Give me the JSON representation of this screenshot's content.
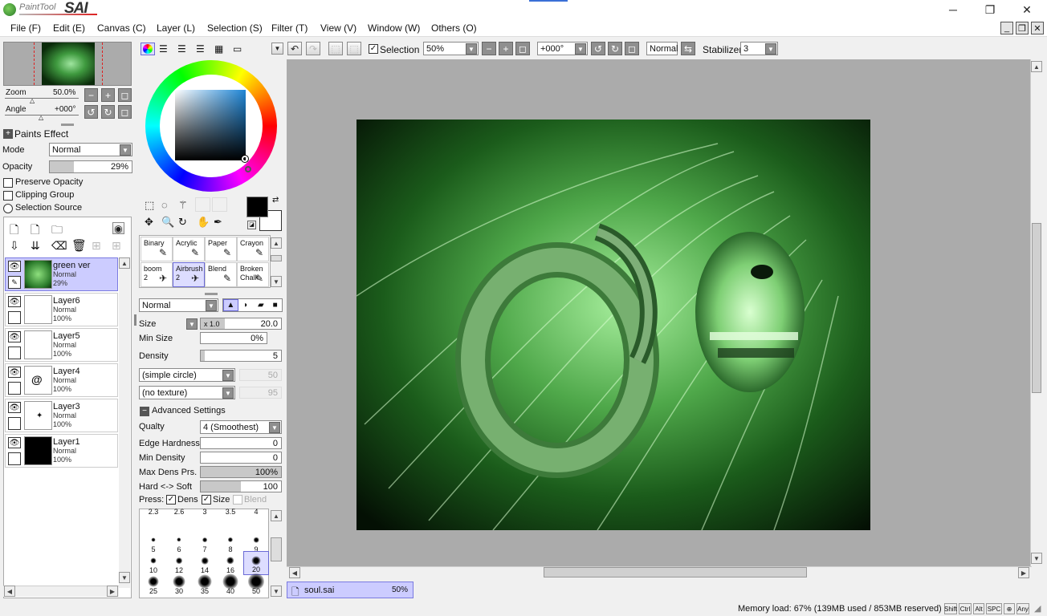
{
  "app": {
    "logo_small": "PaintTool",
    "logo_big": "SAI",
    "window_buttons": [
      "─",
      "❐",
      "✕"
    ]
  },
  "menu": [
    "File (F)",
    "Edit (E)",
    "Canvas (C)",
    "Layer (L)",
    "Selection (S)",
    "Filter (T)",
    "View (V)",
    "Window (W)",
    "Others (O)"
  ],
  "navigator": {
    "zoom_label": "Zoom",
    "zoom_value": "50.0%",
    "angle_label": "Angle",
    "angle_value": "+000°"
  },
  "paints_effect": {
    "header": "Paints Effect",
    "mode_label": "Mode",
    "mode_value": "Normal",
    "opacity_label": "Opacity",
    "opacity_value": "29%",
    "opacity_fraction": 0.29,
    "preserve_opacity": "Preserve Opacity",
    "clipping_group": "Clipping Group",
    "selection_source": "Selection Source"
  },
  "layers": [
    {
      "name": "green ver",
      "mode": "Normal",
      "opacity": "29%",
      "selected": true,
      "thumb": "green"
    },
    {
      "name": "Layer6",
      "mode": "Normal",
      "opacity": "100%",
      "selected": false,
      "thumb": "white"
    },
    {
      "name": "Layer5",
      "mode": "Normal",
      "opacity": "100%",
      "selected": false,
      "thumb": "white"
    },
    {
      "name": "Layer4",
      "mode": "Normal",
      "opacity": "100%",
      "selected": false,
      "thumb": "horn"
    },
    {
      "name": "Layer3",
      "mode": "Normal",
      "opacity": "100%",
      "selected": false,
      "thumb": "mark"
    },
    {
      "name": "Layer1",
      "mode": "Normal",
      "opacity": "100%",
      "selected": false,
      "thumb": "black"
    }
  ],
  "tools": [
    {
      "label": "Binary",
      "icon": "✎"
    },
    {
      "label": "Acrylic",
      "icon": "✎"
    },
    {
      "label": "Paper",
      "icon": "✎"
    },
    {
      "label": "Crayon",
      "icon": "✎"
    },
    {
      "label": "boom\n2",
      "icon": "✈"
    },
    {
      "label": "Airbrush\n2",
      "icon": "✈",
      "selected": true
    },
    {
      "label": "Blend",
      "icon": "✎"
    },
    {
      "label": "Broken\nChalk",
      "icon": "✎"
    }
  ],
  "brush": {
    "blend_mode": "Normal",
    "size_label": "Size",
    "size_mult": "x 1.0",
    "size_value": "20.0",
    "min_size_label": "Min Size",
    "min_size_value": "0%",
    "density_label": "Density",
    "density_value": "5",
    "shape": "(simple circle)",
    "shape_value": "50",
    "texture": "(no texture)",
    "texture_value": "95",
    "advanced_label": "Advanced Settings",
    "quality_label": "Qualty",
    "quality_value": "4 (Smoothest)",
    "edge_label": "Edge Hardness",
    "edge_value": "0",
    "min_density_label": "Min Density",
    "min_density_value": "0",
    "max_dens_label": "Max Dens Prs.",
    "max_dens_value": "100%",
    "hard_soft_label": "Hard <-> Soft",
    "hard_soft_value": "100",
    "press_label": "Press:",
    "press_dens": "Dens",
    "press_size": "Size",
    "press_blend": "Blend"
  },
  "brush_sizes": [
    "2.3",
    "2.6",
    "3",
    "3.5",
    "4",
    "5",
    "6",
    "7",
    "8",
    "9",
    "10",
    "12",
    "14",
    "16",
    "20",
    "25",
    "30",
    "35",
    "40",
    "50"
  ],
  "toolbar": {
    "selection_label": "Selection",
    "zoom_value": "50%",
    "angle_value": "+000°",
    "blend_value": "Normal",
    "stabilizer_label": "Stabilizer",
    "stabilizer_value": "3"
  },
  "document_tab": {
    "name": "soul.sai",
    "zoom": "50%"
  },
  "status": {
    "memory": "Memory load: 67% (139MB used / 853MB reserved)",
    "keys": [
      "Shift",
      "Ctrl",
      "Alt",
      "SPC",
      "⊕",
      "Any"
    ]
  }
}
